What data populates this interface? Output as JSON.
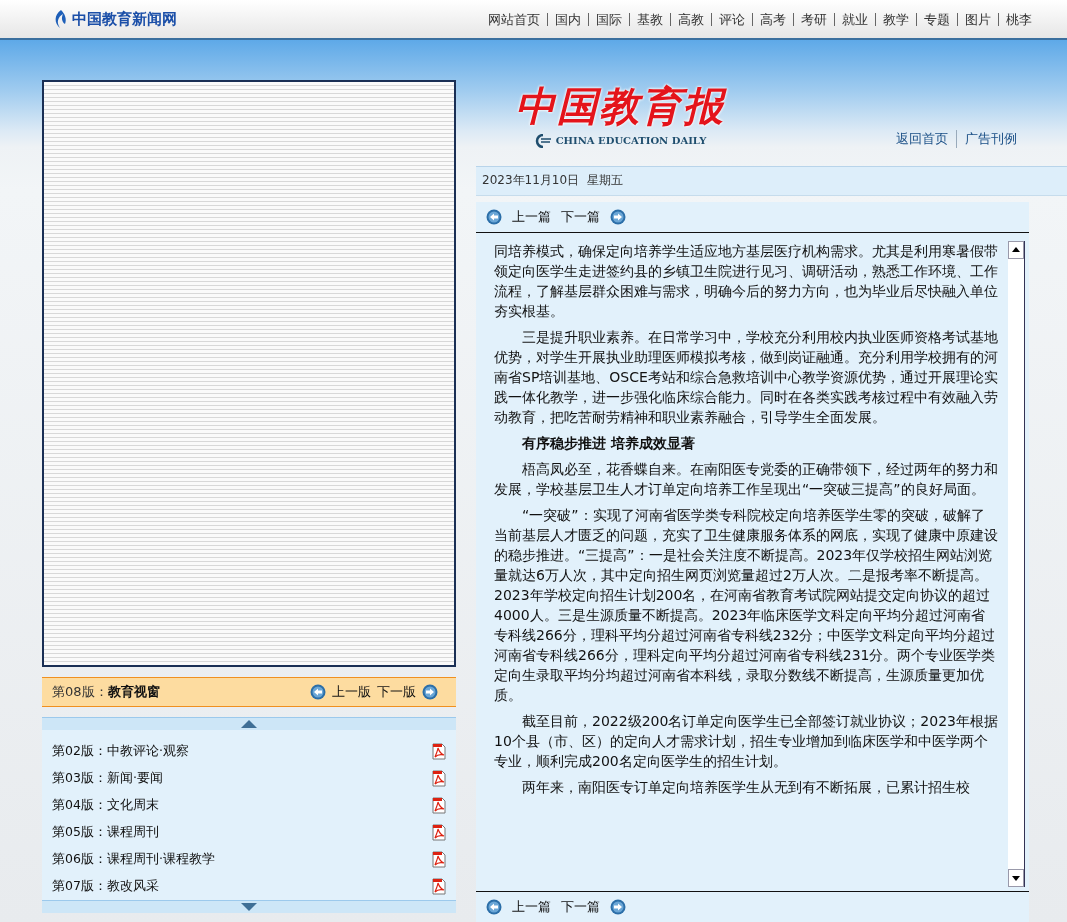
{
  "site": {
    "name": "中国教育新闻网",
    "nav": [
      "网站首页",
      "国内",
      "国际",
      "基教",
      "高教",
      "评论",
      "高考",
      "考研",
      "就业",
      "教学",
      "专题",
      "图片",
      "桃李"
    ]
  },
  "masthead": {
    "title": "中国教育报",
    "subtitle": "CHINA EDUCATION DAILY",
    "links": [
      "返回首页",
      "广告刊例"
    ]
  },
  "date": {
    "day": "2023年11月10日",
    "weekday": "星期五"
  },
  "page_viewer": {
    "label": "第08版：",
    "title": "教育视窗",
    "prev": "上一版",
    "next": "下一版"
  },
  "editions": [
    {
      "label": "第02版：",
      "title": "中教评论·观察"
    },
    {
      "label": "第03版：",
      "title": "新闻·要闻"
    },
    {
      "label": "第04版：",
      "title": "文化周末"
    },
    {
      "label": "第05版：",
      "title": "课程周刊"
    },
    {
      "label": "第06版：",
      "title": "课程周刊·课程教学"
    },
    {
      "label": "第07版：",
      "title": "教改风采"
    }
  ],
  "article": {
    "top_nav": {
      "prev": "上一篇",
      "next": "下一篇"
    },
    "bottom_nav": {
      "prev": "上一篇",
      "next": "下一篇"
    },
    "paragraphs": [
      {
        "kind": "text",
        "text": "同培养模式，确保定向培养学生适应地方基层医疗机构需求。尤其是利用寒暑假带领定向医学生走进签约县的乡镇卫生院进行见习、调研活动，熟悉工作环境、工作流程，了解基层群众困难与需求，明确今后的努力方向，也为毕业后尽快融入单位夯实根基。"
      },
      {
        "kind": "text",
        "text": "　　三是提升职业素养。在日常学习中，学校充分利用校内执业医师资格考试基地优势，对学生开展执业助理医师模拟考核，做到岗证融通。充分利用学校拥有的河南省SP培训基地、OSCE考站和综合急救培训中心教学资源优势，通过开展理论实践一体化教学，进一步强化临床综合能力。同时在各类实践考核过程中有效融入劳动教育，把吃苦耐劳精神和职业素养融合，引导学生全面发展。"
      },
      {
        "kind": "heading",
        "text": "　　有序稳步推进 培养成效显著"
      },
      {
        "kind": "text",
        "text": "　　梧高凤必至，花香蝶自来。在南阳医专党委的正确带领下，经过两年的努力和发展，学校基层卫生人才订单定向培养工作呈现出“一突破三提高”的良好局面。"
      },
      {
        "kind": "text",
        "text": "　　“一突破”：实现了河南省医学类专科院校定向培养医学生零的突破，破解了当前基层人才匮乏的问题，充实了卫生健康服务体系的网底，实现了健康中原建设的稳步推进。“三提高”：一是社会关注度不断提高。2023年仅学校招生网站浏览量就达6万人次，其中定向招生网页浏览量超过2万人次。二是报考率不断提高。2023年学校定向招生计划200名，在河南省教育考试院网站提交定向协议的超过4000人。三是生源质量不断提高。2023年临床医学文科定向平均分超过河南省专科线266分，理科平均分超过河南省专科线232分；中医学文科定向平均分超过河南省专科线266分，理科定向平均分超过河南省专科线231分。两个专业医学类定向生录取平均分均超过河南省本科线，录取分数线不断提高，生源质量更加优质。"
      },
      {
        "kind": "text",
        "text": "　　截至目前，2022级200名订单定向医学生已全部签订就业协议；2023年根据10个县（市、区）的定向人才需求计划，招生专业增加到临床医学和中医学两个专业，顺利完成200名定向医学生的招生计划。"
      },
      {
        "kind": "text",
        "text": "　　两年来，南阳医专订单定向培养医学生从无到有不断拓展，已累计招生校"
      }
    ]
  }
}
